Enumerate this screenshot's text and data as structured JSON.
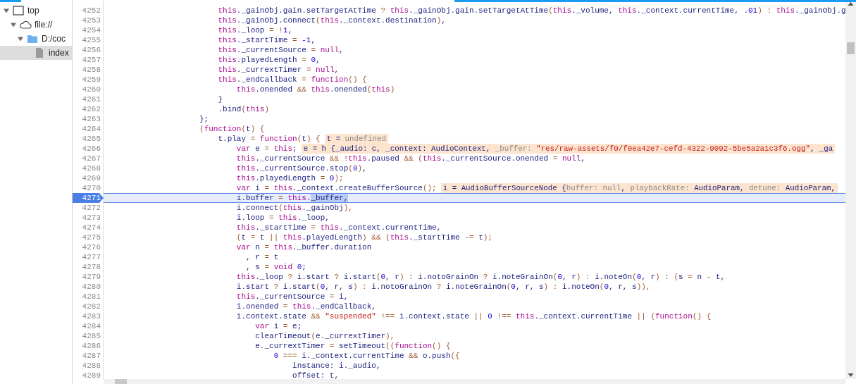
{
  "navigator": {
    "tree": [
      {
        "label": "top",
        "kind": "frame",
        "expanded": true,
        "selected": false,
        "children": [
          {
            "label": "file://",
            "kind": "origin",
            "expanded": true,
            "selected": false,
            "children": [
              {
                "label": "D:/coc",
                "kind": "folder",
                "expanded": true,
                "selected": false,
                "children": [
                  {
                    "label": "index",
                    "kind": "file",
                    "selected": true
                  }
                ]
              }
            ]
          }
        ]
      }
    ]
  },
  "editor": {
    "lines": [
      {
        "number": "4252",
        "current": false,
        "code": [
          {
            "kind": "keyword",
            "text": "                        this"
          },
          {
            "kind": "name",
            "text": "._gainObj.gain.setTargetAtTime "
          },
          {
            "kind": "op",
            "text": "? "
          },
          {
            "kind": "keyword",
            "text": "this"
          },
          {
            "kind": "name",
            "text": "._gainObj.gain.setTargetAtTime"
          },
          {
            "kind": "op",
            "text": "("
          },
          {
            "kind": "keyword",
            "text": "this"
          },
          {
            "kind": "name",
            "text": "._volume, "
          },
          {
            "kind": "keyword",
            "text": "this"
          },
          {
            "kind": "name",
            "text": "._context.currentTime, "
          },
          {
            "kind": "number",
            "text": ".01"
          },
          {
            "kind": "op",
            "text": ") : "
          },
          {
            "kind": "keyword",
            "text": "this"
          },
          {
            "kind": "name",
            "text": "._gainObj.g"
          }
        ]
      },
      {
        "number": "4253",
        "current": false,
        "code": [
          {
            "kind": "keyword",
            "text": "                        this"
          },
          {
            "kind": "name",
            "text": "._gainObj.connect"
          },
          {
            "kind": "op",
            "text": "("
          },
          {
            "kind": "keyword",
            "text": "this"
          },
          {
            "kind": "name",
            "text": "._context.destination"
          },
          {
            "kind": "op",
            "text": ")"
          },
          {
            "kind": "name",
            "text": ","
          }
        ]
      },
      {
        "number": "4254",
        "current": false,
        "code": [
          {
            "kind": "keyword",
            "text": "                        this"
          },
          {
            "kind": "name",
            "text": "._loop "
          },
          {
            "kind": "op",
            "text": "= !"
          },
          {
            "kind": "number",
            "text": "1"
          },
          {
            "kind": "name",
            "text": ","
          }
        ]
      },
      {
        "number": "4255",
        "current": false,
        "code": [
          {
            "kind": "keyword",
            "text": "                        this"
          },
          {
            "kind": "name",
            "text": "._startTime "
          },
          {
            "kind": "op",
            "text": "= "
          },
          {
            "kind": "number",
            "text": "-1"
          },
          {
            "kind": "name",
            "text": ","
          }
        ]
      },
      {
        "number": "4256",
        "current": false,
        "code": [
          {
            "kind": "keyword",
            "text": "                        this"
          },
          {
            "kind": "name",
            "text": "._currentSource "
          },
          {
            "kind": "op",
            "text": "= "
          },
          {
            "kind": "keyword",
            "text": "null"
          },
          {
            "kind": "name",
            "text": ","
          }
        ]
      },
      {
        "number": "4257",
        "current": false,
        "code": [
          {
            "kind": "keyword",
            "text": "                        this"
          },
          {
            "kind": "name",
            "text": ".playedLength "
          },
          {
            "kind": "op",
            "text": "= "
          },
          {
            "kind": "number",
            "text": "0"
          },
          {
            "kind": "name",
            "text": ","
          }
        ]
      },
      {
        "number": "4258",
        "current": false,
        "code": [
          {
            "kind": "keyword",
            "text": "                        this"
          },
          {
            "kind": "name",
            "text": "._currextTimer "
          },
          {
            "kind": "op",
            "text": "= "
          },
          {
            "kind": "keyword",
            "text": "null"
          },
          {
            "kind": "name",
            "text": ","
          }
        ]
      },
      {
        "number": "4259",
        "current": false,
        "code": [
          {
            "kind": "keyword",
            "text": "                        this"
          },
          {
            "kind": "name",
            "text": "._endCallback "
          },
          {
            "kind": "op",
            "text": "= "
          },
          {
            "kind": "keyword",
            "text": "function"
          },
          {
            "kind": "op",
            "text": "() {"
          }
        ]
      },
      {
        "number": "4260",
        "current": false,
        "code": [
          {
            "kind": "keyword",
            "text": "                            this"
          },
          {
            "kind": "name",
            "text": ".onended "
          },
          {
            "kind": "op",
            "text": "&& "
          },
          {
            "kind": "keyword",
            "text": "this"
          },
          {
            "kind": "name",
            "text": ".onended"
          },
          {
            "kind": "op",
            "text": "("
          },
          {
            "kind": "keyword",
            "text": "this"
          },
          {
            "kind": "op",
            "text": ")"
          }
        ]
      },
      {
        "number": "4261",
        "current": false,
        "code": [
          {
            "kind": "name",
            "text": "                        }"
          }
        ]
      },
      {
        "number": "4262",
        "current": false,
        "code": [
          {
            "kind": "name",
            "text": "                        .bind"
          },
          {
            "kind": "op",
            "text": "("
          },
          {
            "kind": "keyword",
            "text": "this"
          },
          {
            "kind": "op",
            "text": ")"
          }
        ]
      },
      {
        "number": "4263",
        "current": false,
        "code": [
          {
            "kind": "name",
            "text": "                    };"
          }
        ]
      },
      {
        "number": "4264",
        "current": false,
        "code": [
          {
            "kind": "op",
            "text": "                    ("
          },
          {
            "kind": "keyword",
            "text": "function"
          },
          {
            "kind": "op",
            "text": "("
          },
          {
            "kind": "name",
            "text": "t"
          },
          {
            "kind": "op",
            "text": ") {"
          }
        ]
      },
      {
        "number": "4265",
        "current": false,
        "code": [
          {
            "kind": "name",
            "text": "                        t.play "
          },
          {
            "kind": "op",
            "text": "= "
          },
          {
            "kind": "keyword",
            "text": "function"
          },
          {
            "kind": "op",
            "text": "("
          },
          {
            "kind": "name",
            "text": "t"
          },
          {
            "kind": "op",
            "text": ") {"
          }
        ],
        "hint": [
          {
            "kind": "name",
            "text": "t = "
          },
          {
            "kind": "dim",
            "text": "undefined"
          }
        ]
      },
      {
        "number": "4266",
        "current": false,
        "code": [
          {
            "kind": "keyword",
            "text": "                            var"
          },
          {
            "kind": "name",
            "text": " e "
          },
          {
            "kind": "op",
            "text": "= "
          },
          {
            "kind": "keyword",
            "text": "this"
          },
          {
            "kind": "name",
            "text": ";"
          }
        ],
        "hint": [
          {
            "kind": "name",
            "text": "e = h {_audio: c, _context: AudioContext, "
          },
          {
            "kind": "dim",
            "text": "_buffer: "
          },
          {
            "kind": "string",
            "text": "\"res/raw-assets/f0/f0ea42e7-cefd-4322-9092-5be5a2a1c3f6.ogg\""
          },
          {
            "kind": "name",
            "text": ", _ga"
          }
        ]
      },
      {
        "number": "4267",
        "current": false,
        "code": [
          {
            "kind": "keyword",
            "text": "                            this"
          },
          {
            "kind": "name",
            "text": "._currentSource "
          },
          {
            "kind": "op",
            "text": "&& !"
          },
          {
            "kind": "keyword",
            "text": "this"
          },
          {
            "kind": "name",
            "text": ".paused "
          },
          {
            "kind": "op",
            "text": "&& ("
          },
          {
            "kind": "keyword",
            "text": "this"
          },
          {
            "kind": "name",
            "text": "._currentSource.onended "
          },
          {
            "kind": "op",
            "text": "= "
          },
          {
            "kind": "keyword",
            "text": "null"
          },
          {
            "kind": "name",
            "text": ","
          }
        ]
      },
      {
        "number": "4268",
        "current": false,
        "code": [
          {
            "kind": "keyword",
            "text": "                            this"
          },
          {
            "kind": "name",
            "text": "._currentSource.stop"
          },
          {
            "kind": "op",
            "text": "("
          },
          {
            "kind": "number",
            "text": "0"
          },
          {
            "kind": "op",
            "text": ")"
          },
          {
            "kind": "name",
            "text": ","
          }
        ]
      },
      {
        "number": "4269",
        "current": false,
        "code": [
          {
            "kind": "keyword",
            "text": "                            this"
          },
          {
            "kind": "name",
            "text": ".playedLength "
          },
          {
            "kind": "op",
            "text": "= "
          },
          {
            "kind": "number",
            "text": "0"
          },
          {
            "kind": "op",
            "text": ");"
          }
        ]
      },
      {
        "number": "4270",
        "current": false,
        "code": [
          {
            "kind": "keyword",
            "text": "                            var"
          },
          {
            "kind": "name",
            "text": " i "
          },
          {
            "kind": "op",
            "text": "= "
          },
          {
            "kind": "keyword",
            "text": "this"
          },
          {
            "kind": "name",
            "text": "._context.createBufferSource"
          },
          {
            "kind": "op",
            "text": "();"
          }
        ],
        "hint": [
          {
            "kind": "name",
            "text": "i = AudioBufferSourceNode {"
          },
          {
            "kind": "dim",
            "text": "buffer: null"
          },
          {
            "kind": "name",
            "text": ", "
          },
          {
            "kind": "dim",
            "text": "playbackRate: "
          },
          {
            "kind": "name",
            "text": "AudioParam, "
          },
          {
            "kind": "dim",
            "text": "detune: "
          },
          {
            "kind": "name",
            "text": "AudioParam,"
          }
        ]
      },
      {
        "number": "4271",
        "current": true,
        "code": [
          {
            "kind": "name",
            "text": "                            i.buffer "
          },
          {
            "kind": "op",
            "text": "= "
          },
          {
            "kind": "keyword",
            "text": "this"
          },
          {
            "kind": "name",
            "text": "."
          },
          {
            "kind": "selection",
            "text": "_buffer,"
          }
        ]
      },
      {
        "number": "4272",
        "current": false,
        "code": [
          {
            "kind": "name",
            "text": "                            i.connect"
          },
          {
            "kind": "op",
            "text": "("
          },
          {
            "kind": "keyword",
            "text": "this"
          },
          {
            "kind": "name",
            "text": "._gainObj"
          },
          {
            "kind": "op",
            "text": "),"
          }
        ]
      },
      {
        "number": "4273",
        "current": false,
        "code": [
          {
            "kind": "name",
            "text": "                            i.loop "
          },
          {
            "kind": "op",
            "text": "= "
          },
          {
            "kind": "keyword",
            "text": "this"
          },
          {
            "kind": "name",
            "text": "._loop,"
          }
        ]
      },
      {
        "number": "4274",
        "current": false,
        "code": [
          {
            "kind": "keyword",
            "text": "                            this"
          },
          {
            "kind": "name",
            "text": "._startTime "
          },
          {
            "kind": "op",
            "text": "= "
          },
          {
            "kind": "keyword",
            "text": "this"
          },
          {
            "kind": "name",
            "text": "._context.currentTime,"
          }
        ]
      },
      {
        "number": "4275",
        "current": false,
        "code": [
          {
            "kind": "op",
            "text": "                            ("
          },
          {
            "kind": "name",
            "text": "t "
          },
          {
            "kind": "op",
            "text": "= "
          },
          {
            "kind": "name",
            "text": "t "
          },
          {
            "kind": "op",
            "text": "|| "
          },
          {
            "kind": "keyword",
            "text": "this"
          },
          {
            "kind": "name",
            "text": ".playedLength"
          },
          {
            "kind": "op",
            "text": ") && ("
          },
          {
            "kind": "keyword",
            "text": "this"
          },
          {
            "kind": "name",
            "text": "._startTime "
          },
          {
            "kind": "op",
            "text": "-= "
          },
          {
            "kind": "name",
            "text": "t"
          },
          {
            "kind": "op",
            "text": ");"
          }
        ]
      },
      {
        "number": "4276",
        "current": false,
        "code": [
          {
            "kind": "keyword",
            "text": "                            var"
          },
          {
            "kind": "name",
            "text": " n "
          },
          {
            "kind": "op",
            "text": "= "
          },
          {
            "kind": "keyword",
            "text": "this"
          },
          {
            "kind": "name",
            "text": "._buffer.duration"
          }
        ]
      },
      {
        "number": "4277",
        "current": false,
        "code": [
          {
            "kind": "name",
            "text": "                              , r "
          },
          {
            "kind": "op",
            "text": "= "
          },
          {
            "kind": "name",
            "text": "t"
          }
        ]
      },
      {
        "number": "4278",
        "current": false,
        "code": [
          {
            "kind": "name",
            "text": "                              , s "
          },
          {
            "kind": "op",
            "text": "= "
          },
          {
            "kind": "keyword",
            "text": "void"
          },
          {
            "kind": "number",
            "text": " 0"
          },
          {
            "kind": "name",
            "text": ";"
          }
        ]
      },
      {
        "number": "4279",
        "current": false,
        "code": [
          {
            "kind": "keyword",
            "text": "                            this"
          },
          {
            "kind": "name",
            "text": "._loop "
          },
          {
            "kind": "op",
            "text": "? "
          },
          {
            "kind": "name",
            "text": "i.start "
          },
          {
            "kind": "op",
            "text": "? "
          },
          {
            "kind": "name",
            "text": "i.start"
          },
          {
            "kind": "op",
            "text": "("
          },
          {
            "kind": "number",
            "text": "0"
          },
          {
            "kind": "name",
            "text": ", r"
          },
          {
            "kind": "op",
            "text": ") : "
          },
          {
            "kind": "name",
            "text": "i.notoGrainOn "
          },
          {
            "kind": "op",
            "text": "? "
          },
          {
            "kind": "name",
            "text": "i.noteGrainOn"
          },
          {
            "kind": "op",
            "text": "("
          },
          {
            "kind": "number",
            "text": "0"
          },
          {
            "kind": "name",
            "text": ", r"
          },
          {
            "kind": "op",
            "text": ") : "
          },
          {
            "kind": "name",
            "text": "i.noteOn"
          },
          {
            "kind": "op",
            "text": "("
          },
          {
            "kind": "number",
            "text": "0"
          },
          {
            "kind": "name",
            "text": ", r"
          },
          {
            "kind": "op",
            "text": ") : ("
          },
          {
            "kind": "name",
            "text": "s "
          },
          {
            "kind": "op",
            "text": "= "
          },
          {
            "kind": "name",
            "text": "n "
          },
          {
            "kind": "op",
            "text": "- "
          },
          {
            "kind": "name",
            "text": "t,"
          }
        ]
      },
      {
        "number": "4280",
        "current": false,
        "code": [
          {
            "kind": "name",
            "text": "                            i.start "
          },
          {
            "kind": "op",
            "text": "? "
          },
          {
            "kind": "name",
            "text": "i.start"
          },
          {
            "kind": "op",
            "text": "("
          },
          {
            "kind": "number",
            "text": "0"
          },
          {
            "kind": "name",
            "text": ", r, s"
          },
          {
            "kind": "op",
            "text": ") : "
          },
          {
            "kind": "name",
            "text": "i.notoGrainOn "
          },
          {
            "kind": "op",
            "text": "? "
          },
          {
            "kind": "name",
            "text": "i.noteGrainOn"
          },
          {
            "kind": "op",
            "text": "("
          },
          {
            "kind": "number",
            "text": "0"
          },
          {
            "kind": "name",
            "text": ", r, s"
          },
          {
            "kind": "op",
            "text": ") : "
          },
          {
            "kind": "name",
            "text": "i.noteOn"
          },
          {
            "kind": "op",
            "text": "("
          },
          {
            "kind": "number",
            "text": "0"
          },
          {
            "kind": "name",
            "text": ", r, s"
          },
          {
            "kind": "op",
            "text": ")),"
          }
        ]
      },
      {
        "number": "4281",
        "current": false,
        "code": [
          {
            "kind": "keyword",
            "text": "                            this"
          },
          {
            "kind": "name",
            "text": "._currentSource "
          },
          {
            "kind": "op",
            "text": "= "
          },
          {
            "kind": "name",
            "text": "i,"
          }
        ]
      },
      {
        "number": "4282",
        "current": false,
        "code": [
          {
            "kind": "name",
            "text": "                            i.onended "
          },
          {
            "kind": "op",
            "text": "= "
          },
          {
            "kind": "keyword",
            "text": "this"
          },
          {
            "kind": "name",
            "text": "._endCallback,"
          }
        ]
      },
      {
        "number": "4283",
        "current": false,
        "code": [
          {
            "kind": "name",
            "text": "                            i.context.state "
          },
          {
            "kind": "op",
            "text": "&& "
          },
          {
            "kind": "string",
            "text": "\"suspended\""
          },
          {
            "kind": "op",
            "text": " !== "
          },
          {
            "kind": "name",
            "text": "i.context.state "
          },
          {
            "kind": "op",
            "text": "|| "
          },
          {
            "kind": "number",
            "text": "0"
          },
          {
            "kind": "op",
            "text": " !== "
          },
          {
            "kind": "keyword",
            "text": "this"
          },
          {
            "kind": "name",
            "text": "._context.currentTime "
          },
          {
            "kind": "op",
            "text": "|| ("
          },
          {
            "kind": "keyword",
            "text": "function"
          },
          {
            "kind": "op",
            "text": "() {"
          }
        ]
      },
      {
        "number": "4284",
        "current": false,
        "code": [
          {
            "kind": "keyword",
            "text": "                                var"
          },
          {
            "kind": "name",
            "text": " i "
          },
          {
            "kind": "op",
            "text": "= "
          },
          {
            "kind": "name",
            "text": "e;"
          }
        ]
      },
      {
        "number": "4285",
        "current": false,
        "code": [
          {
            "kind": "name",
            "text": "                                clearTimeout"
          },
          {
            "kind": "op",
            "text": "("
          },
          {
            "kind": "name",
            "text": "e._currextTimer"
          },
          {
            "kind": "op",
            "text": "),"
          }
        ]
      },
      {
        "number": "4286",
        "current": false,
        "code": [
          {
            "kind": "name",
            "text": "                                e._currextTimer "
          },
          {
            "kind": "op",
            "text": "= "
          },
          {
            "kind": "name",
            "text": "setTimeout"
          },
          {
            "kind": "op",
            "text": "(("
          },
          {
            "kind": "keyword",
            "text": "function"
          },
          {
            "kind": "op",
            "text": "() {"
          }
        ]
      },
      {
        "number": "4287",
        "current": false,
        "code": [
          {
            "kind": "number",
            "text": "                                    0"
          },
          {
            "kind": "op",
            "text": " === "
          },
          {
            "kind": "name",
            "text": "i._context.currentTime "
          },
          {
            "kind": "op",
            "text": "&& "
          },
          {
            "kind": "name",
            "text": "o.push"
          },
          {
            "kind": "op",
            "text": "({"
          }
        ]
      },
      {
        "number": "4288",
        "current": false,
        "code": [
          {
            "kind": "name",
            "text": "                                        instance: i._audio,"
          }
        ]
      },
      {
        "number": "4289",
        "current": false,
        "code": [
          {
            "kind": "name",
            "text": "                                        offset: t,"
          }
        ]
      }
    ]
  }
}
